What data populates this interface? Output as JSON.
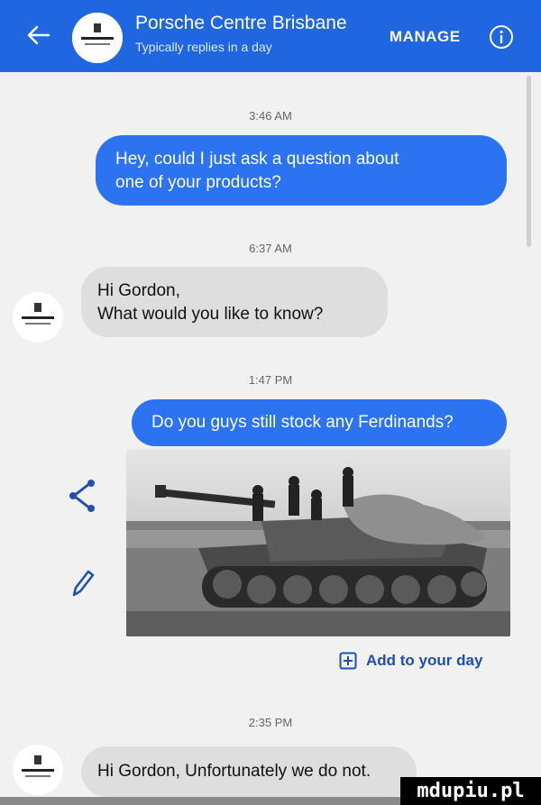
{
  "header": {
    "title": "Porsche Centre Brisbane",
    "subtitle": "Typically replies in a day",
    "manage_label": "MANAGE",
    "back_icon": "arrow-left-icon",
    "info_icon": "info-icon",
    "bg_color": "#1f66e0"
  },
  "messages": [
    {
      "type": "timestamp",
      "text": "3:46 AM"
    },
    {
      "type": "outgoing",
      "lines": [
        "Hey, could I just ask a question about",
        "one of your products?"
      ]
    },
    {
      "type": "timestamp",
      "text": "6:37 AM"
    },
    {
      "type": "incoming",
      "lines": [
        "Hi Gordon,",
        "What would you like to know?"
      ]
    },
    {
      "type": "timestamp",
      "text": "1:47 PM"
    },
    {
      "type": "outgoing",
      "lines": [
        "Do you guys still stock any Ferdinands?"
      ]
    },
    {
      "type": "image",
      "alt_icon": "tank-photo"
    },
    {
      "type": "timestamp",
      "text": "2:35 PM"
    },
    {
      "type": "incoming",
      "lines": [
        "Hi Gordon, Unfortunately we do not."
      ]
    }
  ],
  "add_to_day": {
    "label": "Add to your day",
    "icon": "plus-square-icon"
  },
  "side_actions": {
    "share_icon": "share-icon",
    "edit_icon": "pencil-icon"
  },
  "watermark": "mdupiu.pl",
  "colors": {
    "outgoing": "#2b73f0",
    "incoming": "#dedede",
    "link": "#1f4fb0"
  }
}
